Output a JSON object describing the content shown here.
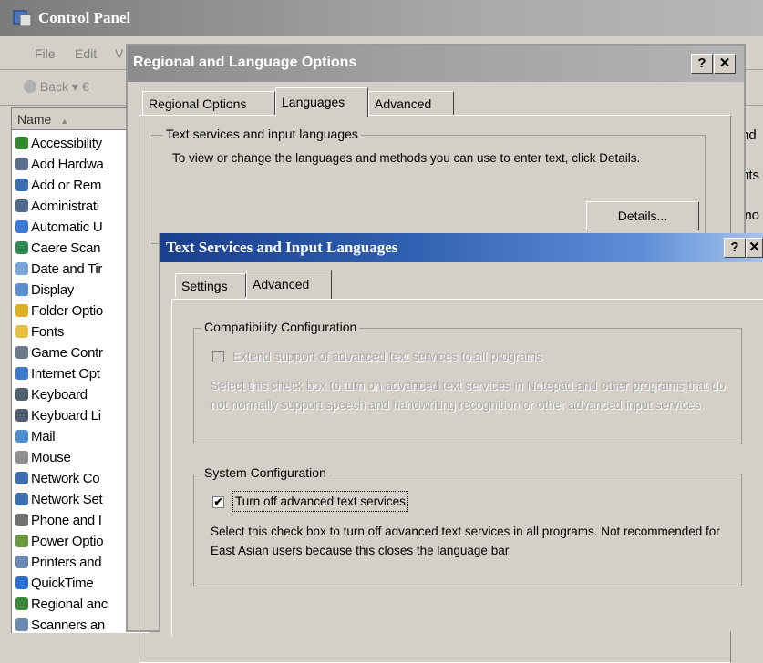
{
  "control_panel": {
    "title": "Control Panel",
    "menu": [
      "File",
      "Edit",
      "V"
    ],
    "toolbar": {
      "back_label": "Back",
      "forward_fragment": "▾ €"
    },
    "column_header": "Name",
    "sort_glyph": "▲",
    "items": [
      {
        "label": "Accessibility",
        "color": "#2e8b2e"
      },
      {
        "label": "Add Hardwa",
        "color": "#5a6e8a"
      },
      {
        "label": "Add or Rem",
        "color": "#3c6fb0"
      },
      {
        "label": "Administrati",
        "color": "#4f6a8a"
      },
      {
        "label": "Automatic U",
        "color": "#3a7bd5"
      },
      {
        "label": "Caere Scan",
        "color": "#2e8b57"
      },
      {
        "label": "Date and Tir",
        "color": "#7aa7d8"
      },
      {
        "label": "Display",
        "color": "#5a8fd0"
      },
      {
        "label": "Folder Optio",
        "color": "#e0b020"
      },
      {
        "label": "Fonts",
        "color": "#e8c040"
      },
      {
        "label": "Game Contr",
        "color": "#6a7a8a"
      },
      {
        "label": "Internet Opt",
        "color": "#3a78c8"
      },
      {
        "label": "Keyboard",
        "color": "#506070"
      },
      {
        "label": "Keyboard Li",
        "color": "#506070"
      },
      {
        "label": "Mail",
        "color": "#4a90d0"
      },
      {
        "label": "Mouse",
        "color": "#909090"
      },
      {
        "label": "Network Co",
        "color": "#3a70b0"
      },
      {
        "label": "Network Set",
        "color": "#3a70b0"
      },
      {
        "label": "Phone and I",
        "color": "#707070"
      },
      {
        "label": "Power Optio",
        "color": "#6a9a40"
      },
      {
        "label": "Printers and",
        "color": "#6a88b0"
      },
      {
        "label": "QuickTime",
        "color": "#2a6fd0"
      },
      {
        "label": "Regional anc",
        "color": "#3a8a3a"
      },
      {
        "label": "Scanners an",
        "color": "#6a88b0"
      }
    ],
    "right_fragments": [
      "nd",
      "",
      "nts",
      "",
      "ino"
    ]
  },
  "regional_dialog": {
    "title": "Regional and Language Options",
    "help_button": "?",
    "close_button": "✕",
    "tabs": [
      {
        "label": "Regional Options",
        "active": false
      },
      {
        "label": "Languages",
        "active": true
      },
      {
        "label": "Advanced",
        "active": false
      }
    ],
    "group_label": "Text services and input languages",
    "group_text": "To view or change the languages and methods you can use to enter text, click Details.",
    "details_button": "Details..."
  },
  "text_services_dialog": {
    "title": "Text Services and Input Languages",
    "help_button": "?",
    "close_button": "✕",
    "tabs": [
      {
        "label": "Settings",
        "active": false
      },
      {
        "label": "Advanced",
        "active": true
      }
    ],
    "compat": {
      "label": "Compatibility Configuration",
      "checkbox_label": "Extend support of advanced text services to all programs",
      "checked": false,
      "enabled": false,
      "description": "Select this check box to turn on advanced text services in Notepad and other programs that do not normally support speech and handwriting recognition or other advanced input services."
    },
    "system": {
      "label": "System Configuration",
      "checkbox_label": "Turn off advanced text services",
      "checked": true,
      "check_glyph": "✔",
      "enabled": true,
      "description": "Select this check box to turn off advanced text services in all programs. Not recommended for East Asian users because this closes the language bar."
    }
  }
}
